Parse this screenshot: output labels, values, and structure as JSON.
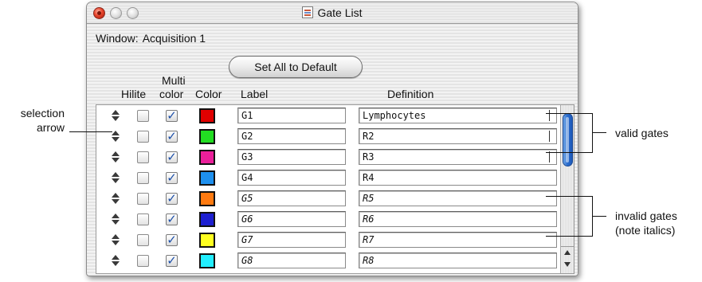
{
  "window": {
    "title": "Gate List",
    "window_label": "Window:",
    "window_value": "Acquisition 1",
    "set_all_default_label": "Set All to Default"
  },
  "columns": {
    "hilite": "Hilite",
    "multi_top": "Multi",
    "multi_bottom": "color",
    "color": "Color",
    "label": "Label",
    "definition": "Definition"
  },
  "rows": [
    {
      "label": "G1",
      "definition": "Lymphocytes",
      "color": "#e00000",
      "multicolor": true,
      "hilite": false,
      "italic": false
    },
    {
      "label": "G2",
      "definition": "R2",
      "color": "#22dd22",
      "multicolor": true,
      "hilite": false,
      "italic": false
    },
    {
      "label": "G3",
      "definition": "R3",
      "color": "#ea1f9a",
      "multicolor": true,
      "hilite": false,
      "italic": false
    },
    {
      "label": "G4",
      "definition": "R4",
      "color": "#1e90ee",
      "multicolor": true,
      "hilite": false,
      "italic": false
    },
    {
      "label": "G5",
      "definition": "R5",
      "color": "#ff7a10",
      "multicolor": true,
      "hilite": false,
      "italic": true
    },
    {
      "label": "G6",
      "definition": "R6",
      "color": "#1d1fd0",
      "multicolor": true,
      "hilite": false,
      "italic": true
    },
    {
      "label": "G7",
      "definition": "R7",
      "color": "#ffff20",
      "multicolor": true,
      "hilite": false,
      "italic": true
    },
    {
      "label": "G8",
      "definition": "R8",
      "color": "#22eeff",
      "multicolor": true,
      "hilite": false,
      "italic": true
    }
  ],
  "annotations": {
    "selection_line1": "selection",
    "selection_line2": "arrow",
    "valid_gates": "valid gates",
    "invalid_line1": "invalid gates",
    "invalid_line2": "(note italics)"
  },
  "icons": {
    "checkmark": "✓"
  }
}
